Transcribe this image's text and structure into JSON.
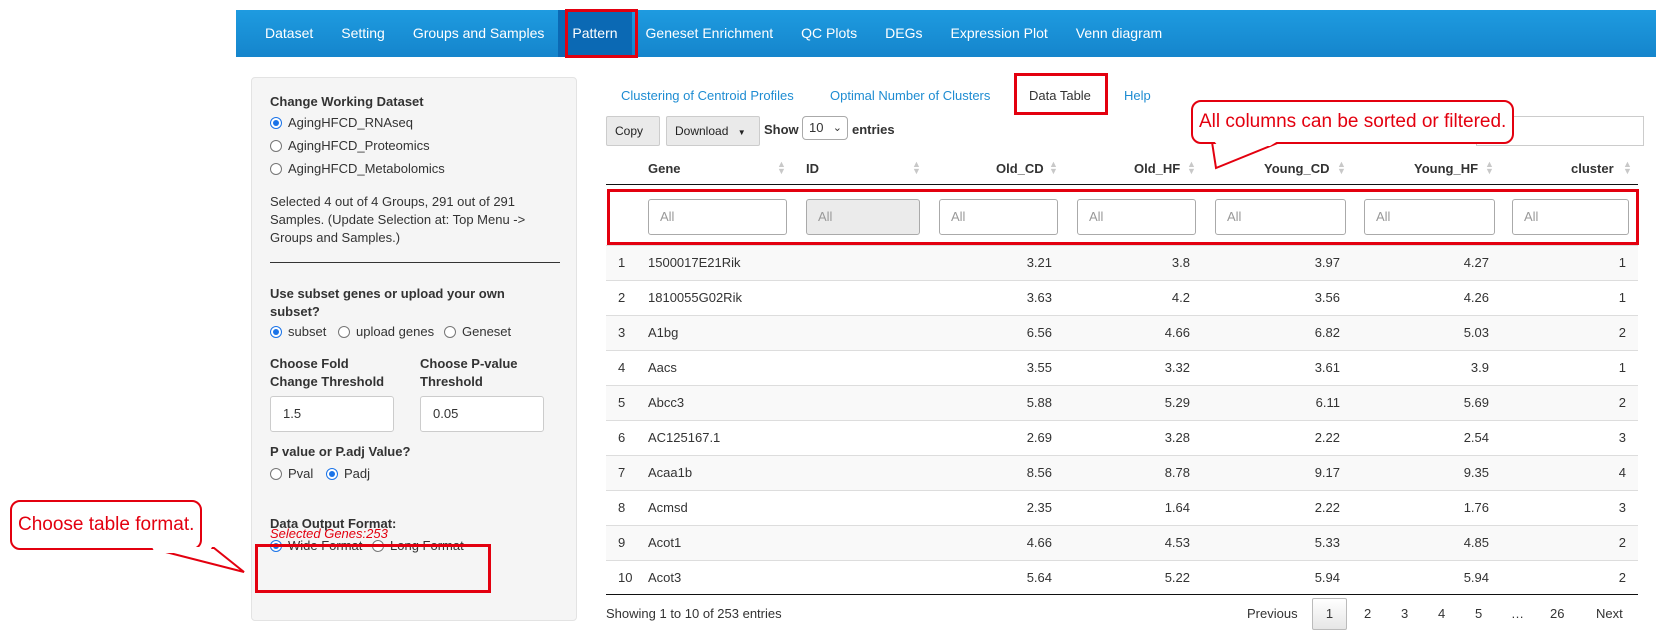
{
  "navbar": {
    "items": [
      "Dataset",
      "Setting",
      "Groups and Samples",
      "Pattern",
      "Geneset Enrichment",
      "QC Plots",
      "DEGs",
      "Expression Plot",
      "Venn diagram"
    ],
    "active": "Pattern"
  },
  "sidebar": {
    "dataset_label": "Change Working Dataset",
    "datasets": [
      "AgingHFCD_RNAseq",
      "AgingHFCD_Proteomics",
      "AgingHFCD_Metabolomics"
    ],
    "selected_dataset": "AgingHFCD_RNAseq",
    "selection_info": [
      "Selected 4 out of 4 Groups, 291 out of 291",
      "Samples. (Update Selection at: Top Menu ->",
      "Groups and Samples.)"
    ],
    "subset_label_1": "Use subset genes or upload your own",
    "subset_label_2": "subset?",
    "subset_options": [
      "subset",
      "upload genes",
      "Geneset"
    ],
    "subset_selected": "subset",
    "fc_label_1": "Choose Fold",
    "fc_label_2": "Change Threshold",
    "fc_value": "1.5",
    "pval_label_1": "Choose P-value",
    "pval_label_2": "Threshold",
    "pval_value": "0.05",
    "ptype_label": "P value or P.adj Value?",
    "ptype_options": [
      "Pval",
      "Padj"
    ],
    "ptype_selected": "Padj",
    "selected_genes": "Selected Genes:253",
    "format_label": "Data Output Format:",
    "format_options": [
      "Wide Format",
      "Long Format"
    ],
    "format_selected": "Wide Format"
  },
  "callouts": {
    "format": "Choose table format.",
    "columns": "All columns can be sorted or filtered."
  },
  "tabs": [
    "Clustering of Centroid Profiles",
    "Optimal Number of Clusters",
    "Data Table",
    "Help"
  ],
  "active_tab": "Data Table",
  "toolbar": {
    "copy": "Copy",
    "download": "Download",
    "show": "Show",
    "length": "10",
    "entries": "entries"
  },
  "table": {
    "columns": [
      "Gene",
      "ID",
      "Old_CD",
      "Old_HF",
      "Young_CD",
      "Young_HF",
      "cluster"
    ],
    "filter_placeholder": "All",
    "rows": [
      [
        "1",
        "1500017E21Rik",
        "3.21",
        "3.8",
        "3.97",
        "4.27",
        "1"
      ],
      [
        "2",
        "1810055G02Rik",
        "3.63",
        "4.2",
        "3.56",
        "4.26",
        "1"
      ],
      [
        "3",
        "A1bg",
        "6.56",
        "4.66",
        "6.82",
        "5.03",
        "2"
      ],
      [
        "4",
        "Aacs",
        "3.55",
        "3.32",
        "3.61",
        "3.9",
        "1"
      ],
      [
        "5",
        "Abcc3",
        "5.88",
        "5.29",
        "6.11",
        "5.69",
        "2"
      ],
      [
        "6",
        "AC125167.1",
        "2.69",
        "3.28",
        "2.22",
        "2.54",
        "3"
      ],
      [
        "7",
        "Acaa1b",
        "8.56",
        "8.78",
        "9.17",
        "9.35",
        "4"
      ],
      [
        "8",
        "Acmsd",
        "2.35",
        "1.64",
        "2.22",
        "1.76",
        "3"
      ],
      [
        "9",
        "Acot1",
        "4.66",
        "4.53",
        "5.33",
        "4.85",
        "2"
      ],
      [
        "10",
        "Acot3",
        "5.64",
        "5.22",
        "5.94",
        "5.94",
        "2"
      ]
    ]
  },
  "footer": {
    "info": "Showing 1 to 10 of 253 entries",
    "previous": "Previous",
    "pages": [
      "1",
      "2",
      "3",
      "4",
      "5",
      "…",
      "26"
    ],
    "next": "Next"
  }
}
